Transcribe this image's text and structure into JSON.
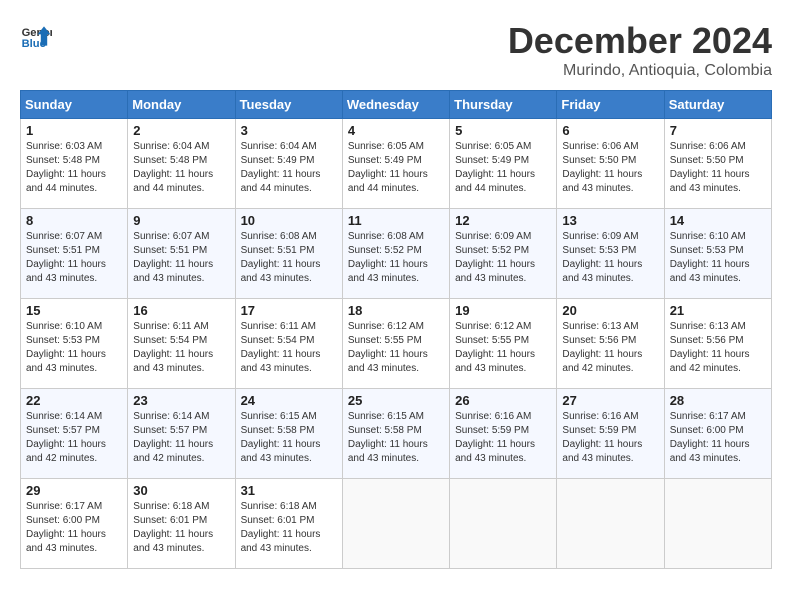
{
  "header": {
    "logo_general": "General",
    "logo_blue": "Blue",
    "month_title": "December 2024",
    "location": "Murindo, Antioquia, Colombia"
  },
  "calendar": {
    "days_of_week": [
      "Sunday",
      "Monday",
      "Tuesday",
      "Wednesday",
      "Thursday",
      "Friday",
      "Saturday"
    ],
    "weeks": [
      [
        {
          "day": "1",
          "sunrise": "6:03 AM",
          "sunset": "5:48 PM",
          "daylight": "11 hours and 44 minutes."
        },
        {
          "day": "2",
          "sunrise": "6:04 AM",
          "sunset": "5:48 PM",
          "daylight": "11 hours and 44 minutes."
        },
        {
          "day": "3",
          "sunrise": "6:04 AM",
          "sunset": "5:49 PM",
          "daylight": "11 hours and 44 minutes."
        },
        {
          "day": "4",
          "sunrise": "6:05 AM",
          "sunset": "5:49 PM",
          "daylight": "11 hours and 44 minutes."
        },
        {
          "day": "5",
          "sunrise": "6:05 AM",
          "sunset": "5:49 PM",
          "daylight": "11 hours and 44 minutes."
        },
        {
          "day": "6",
          "sunrise": "6:06 AM",
          "sunset": "5:50 PM",
          "daylight": "11 hours and 43 minutes."
        },
        {
          "day": "7",
          "sunrise": "6:06 AM",
          "sunset": "5:50 PM",
          "daylight": "11 hours and 43 minutes."
        }
      ],
      [
        {
          "day": "8",
          "sunrise": "6:07 AM",
          "sunset": "5:51 PM",
          "daylight": "11 hours and 43 minutes."
        },
        {
          "day": "9",
          "sunrise": "6:07 AM",
          "sunset": "5:51 PM",
          "daylight": "11 hours and 43 minutes."
        },
        {
          "day": "10",
          "sunrise": "6:08 AM",
          "sunset": "5:51 PM",
          "daylight": "11 hours and 43 minutes."
        },
        {
          "day": "11",
          "sunrise": "6:08 AM",
          "sunset": "5:52 PM",
          "daylight": "11 hours and 43 minutes."
        },
        {
          "day": "12",
          "sunrise": "6:09 AM",
          "sunset": "5:52 PM",
          "daylight": "11 hours and 43 minutes."
        },
        {
          "day": "13",
          "sunrise": "6:09 AM",
          "sunset": "5:53 PM",
          "daylight": "11 hours and 43 minutes."
        },
        {
          "day": "14",
          "sunrise": "6:10 AM",
          "sunset": "5:53 PM",
          "daylight": "11 hours and 43 minutes."
        }
      ],
      [
        {
          "day": "15",
          "sunrise": "6:10 AM",
          "sunset": "5:53 PM",
          "daylight": "11 hours and 43 minutes."
        },
        {
          "day": "16",
          "sunrise": "6:11 AM",
          "sunset": "5:54 PM",
          "daylight": "11 hours and 43 minutes."
        },
        {
          "day": "17",
          "sunrise": "6:11 AM",
          "sunset": "5:54 PM",
          "daylight": "11 hours and 43 minutes."
        },
        {
          "day": "18",
          "sunrise": "6:12 AM",
          "sunset": "5:55 PM",
          "daylight": "11 hours and 43 minutes."
        },
        {
          "day": "19",
          "sunrise": "6:12 AM",
          "sunset": "5:55 PM",
          "daylight": "11 hours and 43 minutes."
        },
        {
          "day": "20",
          "sunrise": "6:13 AM",
          "sunset": "5:56 PM",
          "daylight": "11 hours and 42 minutes."
        },
        {
          "day": "21",
          "sunrise": "6:13 AM",
          "sunset": "5:56 PM",
          "daylight": "11 hours and 42 minutes."
        }
      ],
      [
        {
          "day": "22",
          "sunrise": "6:14 AM",
          "sunset": "5:57 PM",
          "daylight": "11 hours and 42 minutes."
        },
        {
          "day": "23",
          "sunrise": "6:14 AM",
          "sunset": "5:57 PM",
          "daylight": "11 hours and 42 minutes."
        },
        {
          "day": "24",
          "sunrise": "6:15 AM",
          "sunset": "5:58 PM",
          "daylight": "11 hours and 43 minutes."
        },
        {
          "day": "25",
          "sunrise": "6:15 AM",
          "sunset": "5:58 PM",
          "daylight": "11 hours and 43 minutes."
        },
        {
          "day": "26",
          "sunrise": "6:16 AM",
          "sunset": "5:59 PM",
          "daylight": "11 hours and 43 minutes."
        },
        {
          "day": "27",
          "sunrise": "6:16 AM",
          "sunset": "5:59 PM",
          "daylight": "11 hours and 43 minutes."
        },
        {
          "day": "28",
          "sunrise": "6:17 AM",
          "sunset": "6:00 PM",
          "daylight": "11 hours and 43 minutes."
        }
      ],
      [
        {
          "day": "29",
          "sunrise": "6:17 AM",
          "sunset": "6:00 PM",
          "daylight": "11 hours and 43 minutes."
        },
        {
          "day": "30",
          "sunrise": "6:18 AM",
          "sunset": "6:01 PM",
          "daylight": "11 hours and 43 minutes."
        },
        {
          "day": "31",
          "sunrise": "6:18 AM",
          "sunset": "6:01 PM",
          "daylight": "11 hours and 43 minutes."
        },
        null,
        null,
        null,
        null
      ]
    ]
  }
}
